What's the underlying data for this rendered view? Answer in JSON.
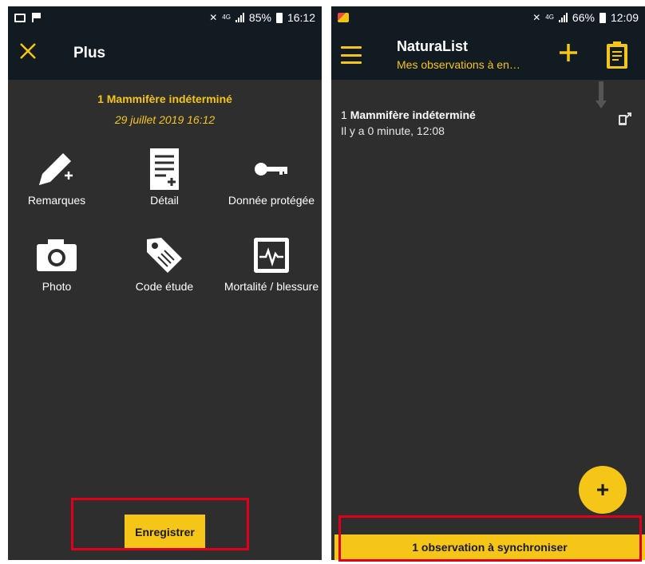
{
  "left": {
    "status": {
      "battery": "85%",
      "time": "16:12",
      "network": "4G"
    },
    "title": "Plus",
    "observation": {
      "title": "1 Mammifère indéterminé",
      "date": "29 juillet 2019 16:12"
    },
    "grid": [
      {
        "label": "Remarques",
        "icon": "pencil-add-icon"
      },
      {
        "label": "Détail",
        "icon": "document-add-icon"
      },
      {
        "label": "Donnée protégée",
        "icon": "key-icon"
      },
      {
        "label": "Photo",
        "icon": "camera-icon"
      },
      {
        "label": "Code étude",
        "icon": "tag-icon"
      },
      {
        "label": "Mortalité / blessure",
        "icon": "heartbeat-monitor-icon"
      }
    ],
    "save_label": "Enregistrer"
  },
  "right": {
    "status": {
      "battery": "66%",
      "time": "12:09",
      "network": "4G"
    },
    "app_title": "NaturaList",
    "app_subtitle": "Mes observations à en…",
    "list": [
      {
        "count": "1",
        "name": "Mammifère indéterminé",
        "time": "Il y a 0 minute, 12:08"
      }
    ],
    "fab_label": "+",
    "sync_label": "1 observation à synchroniser"
  },
  "colors": {
    "accent": "#f5c518",
    "bar": "#121a22",
    "background": "#2e2e2e",
    "highlight": "#e0001b"
  }
}
